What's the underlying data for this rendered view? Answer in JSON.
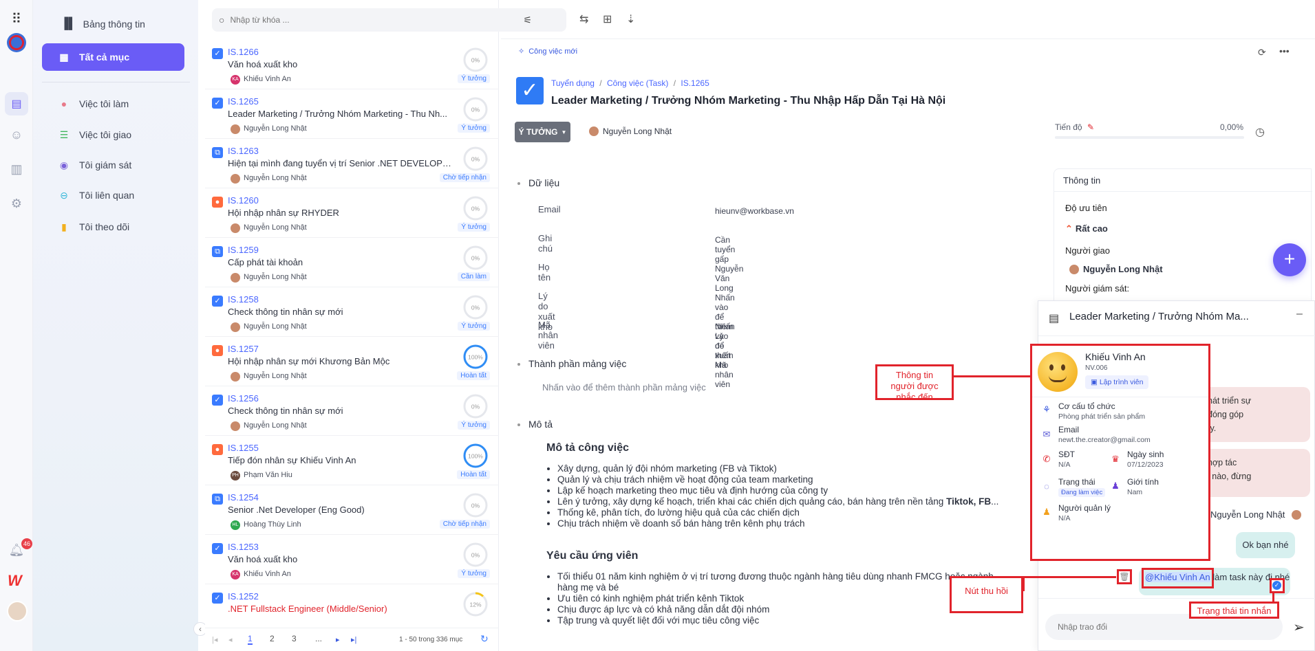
{
  "sidebar": {
    "dashboard": "Bảng thông tin",
    "all": "Tất cả mục",
    "items": [
      {
        "label": "Việc tôi làm"
      },
      {
        "label": "Việc tôi giao"
      },
      {
        "label": "Tôi giám sát"
      },
      {
        "label": "Tôi liên quan"
      },
      {
        "label": "Tôi theo dõi"
      }
    ],
    "notif_count": "46"
  },
  "search": {
    "placeholder": "Nhập từ khóa ..."
  },
  "tasks": [
    {
      "code": "IS.1266",
      "title": "Văn hoá xuất kho",
      "person": "Khiếu Vinh An",
      "initials": "KA",
      "avatar_color": "#d6336c",
      "progress": 0,
      "progress_label": "0%",
      "tag": "Ý tưởng",
      "icon": "checkbox"
    },
    {
      "code": "IS.1265",
      "title": "Leader Marketing / Trưởng Nhóm Marketing - Thu Nh...",
      "person": "Nguyễn Long Nhật",
      "initials": "",
      "avatar_color": "#c98a6a",
      "progress": 0,
      "progress_label": "0%",
      "tag": "Ý tưởng",
      "icon": "checkbox"
    },
    {
      "code": "IS.1263",
      "title": "Hiện tại mình đang tuyển vị trí Senior .NET DEVELOPE...",
      "person": "Nguyễn Long Nhật",
      "initials": "",
      "avatar_color": "#c98a6a",
      "progress": 0,
      "progress_label": "0%",
      "tag": "Chờ tiếp nhận",
      "icon": "subtask"
    },
    {
      "code": "IS.1260",
      "title": "Hội nhập nhân sự RHYDER",
      "person": "Nguyễn Long Nhật",
      "initials": "",
      "avatar_color": "#c98a6a",
      "progress": 0,
      "progress_label": "0%",
      "tag": "Ý tưởng",
      "icon": "record"
    },
    {
      "code": "IS.1259",
      "title": "Cấp phát tài khoản",
      "person": "Nguyễn Long Nhật",
      "initials": "",
      "avatar_color": "#c98a6a",
      "progress": 0,
      "progress_label": "0%",
      "tag": "Cần làm",
      "icon": "subtask"
    },
    {
      "code": "IS.1258",
      "title": "Check thông tin nhân sự mới",
      "person": "Nguyễn Long Nhật",
      "initials": "",
      "avatar_color": "#c98a6a",
      "progress": 0,
      "progress_label": "0%",
      "tag": "Ý tưởng",
      "icon": "checkbox"
    },
    {
      "code": "IS.1257",
      "title": "Hội nhập nhân sự mới Khương Bản Mộc",
      "person": "Nguyễn Long Nhật",
      "initials": "",
      "avatar_color": "#c98a6a",
      "progress": 100,
      "progress_label": "100%",
      "tag": "Hoàn tất",
      "icon": "record"
    },
    {
      "code": "IS.1256",
      "title": "Check thông tin nhân sự mới",
      "person": "Nguyễn Long Nhật",
      "initials": "",
      "avatar_color": "#c98a6a",
      "progress": 0,
      "progress_label": "0%",
      "tag": "Ý tưởng",
      "icon": "checkbox"
    },
    {
      "code": "IS.1255",
      "title": "Tiếp đón nhân sự Khiếu Vinh An",
      "person": "Phạm Văn Hiu",
      "initials": "PH",
      "avatar_color": "#6b4b3e",
      "progress": 100,
      "progress_label": "100%",
      "tag": "Hoàn tất",
      "icon": "record"
    },
    {
      "code": "IS.1254",
      "title": "Senior .Net Developer (Eng Good)",
      "person": "Hoàng Thùy Linh",
      "initials": "HL",
      "avatar_color": "#2fa84f",
      "progress": 0,
      "progress_label": "0%",
      "tag": "Chờ tiếp nhận",
      "icon": "subtask"
    },
    {
      "code": "IS.1253",
      "title": "Văn hoá xuất kho",
      "person": "Khiếu Vinh An",
      "initials": "KA",
      "avatar_color": "#d6336c",
      "progress": 0,
      "progress_label": "0%",
      "tag": "Ý tưởng",
      "icon": "checkbox"
    },
    {
      "code": "IS.1252",
      "title": ".NET Fullstack Engineer (Middle/Senior)",
      "person": "",
      "initials": "",
      "avatar_color": "#c98a6a",
      "progress": 12,
      "progress_label": "12%",
      "tag": "",
      "icon": "checkbox",
      "title_red": true
    }
  ],
  "pagination": {
    "p1": "1",
    "p2": "2",
    "p3": "3",
    "dots": "...",
    "summary": "1 - 50 trong 336 mục"
  },
  "detail": {
    "new_task": "Công việc mới",
    "breadcrumb": [
      "Tuyển dụng",
      "Công việc (Task)",
      "IS.1265"
    ],
    "title": "Leader Marketing / Trưởng Nhóm Marketing - Thu Nhập Hấp Dẫn Tại Hà Nội",
    "status": "Ý TƯỞNG",
    "assignee": "Nguyễn Long Nhật",
    "progress_label": "Tiến độ",
    "progress_value": "0,00%",
    "data_section": "Dữ liệu",
    "fields": [
      {
        "label": "Email",
        "value": "hieunv@workbase.vn"
      },
      {
        "label": "Ghi chú",
        "value": "Cần tuyển gấp"
      },
      {
        "label": "Họ tên",
        "value": "Nguyễn Văn Long"
      },
      {
        "label": "Lý do xuất kho",
        "value": "Nhấn vào để thêm Lý do xuất kho"
      },
      {
        "label": "Mã nhân viên",
        "value": "Nhấn vào để thêm Mã nhân viên"
      }
    ],
    "components_section": "Thành phần mảng việc",
    "components_placeholder": "Nhấn vào để thêm thành phần mảng việc",
    "desc_section": "Mô tả",
    "desc_h1": "Mô tả công việc",
    "desc_items1": [
      "Xây dựng, quản lý đội nhóm marketing (FB và Tiktok)",
      "Quản lý và chịu trách nhiệm về hoạt động của team marketing",
      "Lập kế hoạch marketing theo mục tiêu và định hướng của công ty",
      "Lên ý tưởng, xây dựng kế hoạch, triển khai các chiến dịch quảng cáo, bán hàng trên nền tảng ",
      "Thống kê, phân tích, đo lường hiệu quả của các chiến dịch",
      "Chịu trách nhiệm về doanh số bán hàng trên kênh phụ trách"
    ],
    "desc_bold": "Tiktok, FB",
    "desc_bold_tail": "...",
    "desc_h2": "Yêu cầu ứng viên",
    "desc_items2": [
      "Tối thiểu 01 năm kinh nghiệm ở vị trí tương đương thuộc ngành hàng tiêu dùng nhanh FMCG hoặc ngành hàng mẹ và bé",
      "Ưu tiên có kinh nghiệm phát triển kênh Tiktok",
      "Chịu được áp lực và có khả năng dẫn dắt đội nhóm",
      "Tập trung và quyết liệt đối với mục tiêu công việc"
    ]
  },
  "info": {
    "header": "Thông tin",
    "priority_label": "Độ ưu tiên",
    "priority_value": "Rất cao",
    "assigner_label": "Người giao",
    "assigner_value": "Nguyễn Long Nhật",
    "supervisor_label": "Người giám sát:"
  },
  "chat": {
    "title": "Leader Marketing / Trưởng Nhóm Ma...",
    "bubble1": [
      "hát triển sự",
      "đóng góp",
      "ty."
    ],
    "bubble2": [
      "hợp tác",
      "i nào, đừng"
    ],
    "sender": "Nguyễn Long Nhật",
    "reply": "Ok bạn nhé",
    "mention": "@Khiếu Vinh An",
    "mention_tail": " làm task này đi nhé",
    "input_placeholder": "Nhập trao đổi"
  },
  "popup": {
    "name": "Khiếu Vinh An",
    "code": "NV.006",
    "role": "Lập trình viên",
    "org_label": "Cơ cấu tổ chức",
    "org_value": "Phòng phát triển sản phẩm",
    "email_label": "Email",
    "email_value": "newt.the.creator@gmail.com",
    "phone_label": "SĐT",
    "phone_value": "N/A",
    "birth_label": "Ngày sinh",
    "birth_value": "07/12/2023",
    "status_label": "Trạng thái",
    "status_value": "Đang làm việc",
    "gender_label": "Giới tính",
    "gender_value": "Nam",
    "manager_label": "Người quản lý",
    "manager_value": "N/A"
  },
  "annotations": {
    "mentioned": "Thông tin người được nhắc đến",
    "recall": "Nút thu hồi",
    "status": "Trạng thái tin nhắn"
  },
  "colors": {
    "accent": "#6a5cf6",
    "link": "#4a66ff",
    "annotation": "#e1232b"
  }
}
